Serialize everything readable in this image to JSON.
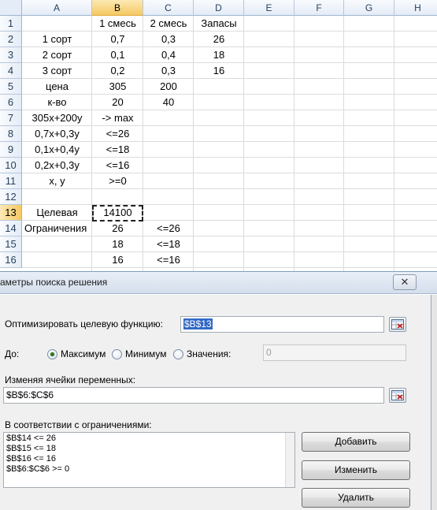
{
  "spreadsheet": {
    "columns": [
      "A",
      "B",
      "C",
      "D",
      "E",
      "F",
      "G",
      "H"
    ],
    "selected_column": "B",
    "rows": [
      "1",
      "2",
      "3",
      "4",
      "5",
      "6",
      "7",
      "8",
      "9",
      "10",
      "11",
      "12",
      "13",
      "14",
      "15",
      "16"
    ],
    "selected_row": "13",
    "cells": {
      "B1": "1 смесь",
      "C1": "2 смесь",
      "D1": "Запасы",
      "A2": "1 сорт",
      "B2": "0,7",
      "C2": "0,3",
      "D2": "26",
      "A3": "2 сорт",
      "B3": "0,1",
      "C3": "0,4",
      "D3": "18",
      "A4": "3 сорт",
      "B4": "0,2",
      "C4": "0,3",
      "D4": "16",
      "A5": "цена",
      "B5": "305",
      "C5": "200",
      "A6": "к-во",
      "B6": "20",
      "C6": "40",
      "A7": "305x+200y",
      "B7": "-> max",
      "A8": "0,7x+0,3y",
      "B8": "<=26",
      "A9": "0,1x+0,4y",
      "B9": "<=18",
      "A10": "0,2x+0,3y",
      "B10": "<=16",
      "A11": "x, y",
      "B11": ">=0",
      "A13": "Целевая",
      "B13": "14100",
      "A14": "Ограничения",
      "B14": "26",
      "C14": "<=26",
      "B15": "18",
      "C15": "<=18",
      "B16": "16",
      "C16": "<=16"
    },
    "active_cell": "B13"
  },
  "dialog": {
    "title": "аметры поиска решения",
    "close_symbol": "✕",
    "objective_label": "Оптимизировать целевую функцию:",
    "objective_value": "$B$13",
    "to_label": "До:",
    "radio_max": "Максимум",
    "radio_min": "Минимум",
    "radio_value": "Значения:",
    "selected_option": "Максимум",
    "value_field": "0",
    "variables_label": "Изменяя ячейки переменных:",
    "variables_value": "$B$6:$C$6",
    "constraints_label": "В соответствии с ограничениями:",
    "constraints": [
      "$B$14 <= 26",
      "$B$15 <= 18",
      "$B$16 <= 16",
      "$B$6:$C$6 >= 0"
    ],
    "add_button": "Добавить",
    "change_button": "Изменить",
    "delete_button": "Удалить",
    "ref_icon": "range-select-icon"
  }
}
